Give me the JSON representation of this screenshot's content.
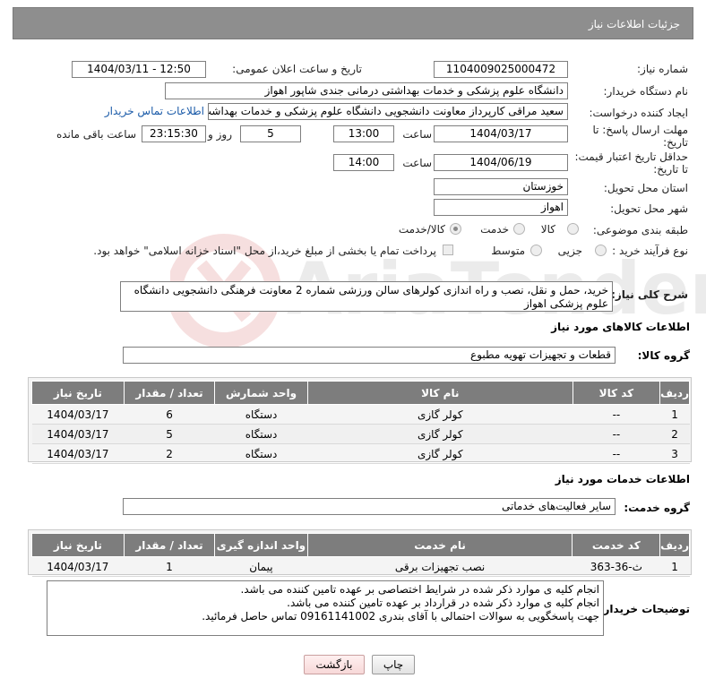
{
  "header": {
    "title": "جزئیات اطلاعات نیاز"
  },
  "fields": {
    "need_number_label": "شماره نیاز:",
    "need_number": "1104009025000472",
    "announce_label": "تاریخ و ساعت اعلان عمومی:",
    "announce_value": "1404/03/11 - 12:50",
    "buyer_org_label": "نام دستگاه خریدار:",
    "buyer_org": "دانشگاه علوم پزشکی و خدمات بهداشتی درمانی جندی شاپور اهواز",
    "creator_label": "ایجاد کننده درخواست:",
    "creator": "سعید مراقی کارپرداز معاونت دانشجویی دانشگاه علوم پزشکی و خدمات بهداشت",
    "contact_link": "اطلاعات تماس خریدار",
    "reply_deadline_label_1": "مهلت ارسال پاسخ: تا",
    "reply_deadline_label_2": "تاریخ:",
    "reply_date": "1404/03/17",
    "time_label": "ساعت",
    "reply_time": "13:00",
    "days_value": "5",
    "days_label": "روز و",
    "remaining_time": "23:15:30",
    "remaining_label": "ساعت باقی مانده",
    "price_deadline_label_1": "حداقل تاریخ اعتبار قیمت:",
    "price_deadline_label_2": "تا تاریخ:",
    "price_date": "1404/06/19",
    "price_time": "14:00",
    "province_label": "استان محل تحویل:",
    "province": "خوزستان",
    "city_label": "شهر محل تحویل:",
    "city": "اهواز",
    "category_label": "طبقه بندی موضوعی:",
    "category_options": [
      "کالا",
      "خدمت",
      "کالا/خدمت"
    ],
    "category_selected": "کالا/خدمت",
    "process_label": "نوع فرآیند خرید :",
    "process_options": [
      "جزیی",
      "متوسط"
    ],
    "payment_note": "پرداخت تمام یا بخشی از مبلغ خرید،از محل \"اسناد خزانه اسلامی\" خواهد بود.",
    "summary_label": "شرح کلی نیاز:",
    "summary": "خرید، حمل و نقل، نصب و راه اندازی کولرهای سالن ورزشی شماره 2 معاونت فرهنگی دانشجویی دانشگاه علوم پزشکی اهواز"
  },
  "goods": {
    "section_title": "اطلاعات کالاهای مورد نیاز",
    "group_label": "گروه کالا:",
    "group_value": "قطعات و تجهیزات تهویه مطبوع",
    "columns": [
      "ردیف",
      "کد کالا",
      "نام کالا",
      "واحد شمارش",
      "تعداد / مقدار",
      "تاریخ نیاز"
    ],
    "rows": [
      [
        "1",
        "--",
        "کولر گازی",
        "دستگاه",
        "6",
        "1404/03/17"
      ],
      [
        "2",
        "--",
        "کولر گازی",
        "دستگاه",
        "5",
        "1404/03/17"
      ],
      [
        "3",
        "--",
        "کولر گازی",
        "دستگاه",
        "2",
        "1404/03/17"
      ]
    ]
  },
  "services": {
    "section_title": "اطلاعات خدمات مورد نیاز",
    "group_label": "گروه خدمت:",
    "group_value": "سایر فعالیت‌های خدماتی",
    "columns": [
      "ردیف",
      "کد خدمت",
      "نام خدمت",
      "واحد اندازه گیری",
      "تعداد / مقدار",
      "تاریخ نیاز"
    ],
    "rows": [
      [
        "1",
        "ث-36-363",
        "نصب تجهیزات برقی",
        "پیمان",
        "1",
        "1404/03/17"
      ]
    ]
  },
  "notes": {
    "label": "توضیحات خریدار:",
    "lines": [
      "انجام کلیه ی موارد ذکر شده در شرایط اختصاصی بر عهده تامین کننده می باشد.",
      "انجام کلیه ی موارد ذکر شده در قرارداد بر عهده تامین کننده می باشد.",
      "جهت پاسخگویی به سوالات احتمالی با آقای بندری 09161141002 تماس حاصل فرمائید."
    ]
  },
  "buttons": {
    "print": "چاپ",
    "back": "بازگشت"
  },
  "watermark_text": "AriaTender.neT"
}
